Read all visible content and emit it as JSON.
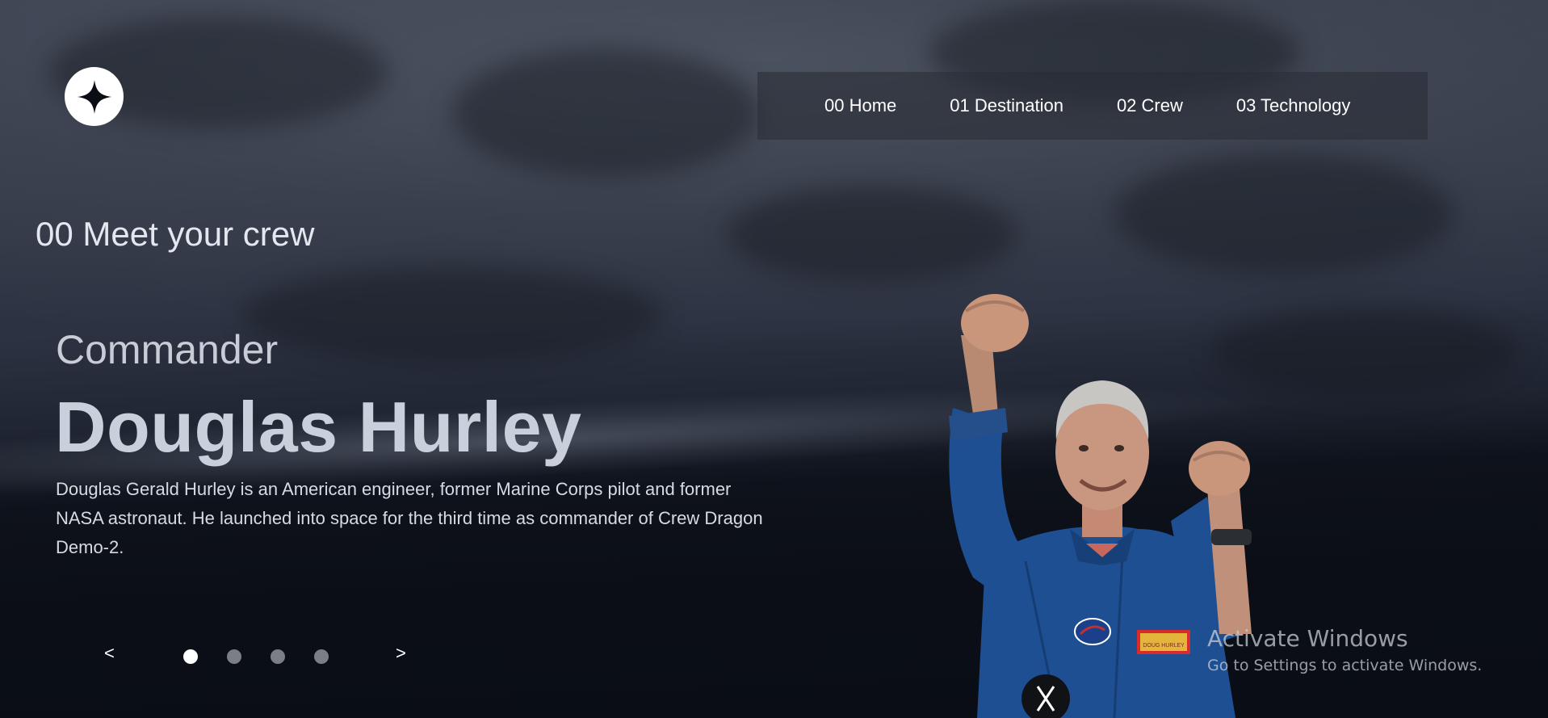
{
  "nav": {
    "items": [
      {
        "label": "00 Home"
      },
      {
        "label": "01 Destination"
      },
      {
        "label": "02 Crew"
      },
      {
        "label": "03 Technology"
      }
    ]
  },
  "page": {
    "section_title": "00 Meet your crew"
  },
  "crew": {
    "role": "Commander",
    "name": "Douglas Hurley",
    "bio": "Douglas Gerald Hurley is an American engineer, former Marine Corps pilot and former NASA astronaut. He launched into space for the third time as commander of Crew Dragon Demo-2."
  },
  "carousel": {
    "prev_label": "<",
    "next_label": ">",
    "active_index": 0,
    "dot_count": 4
  },
  "badge": {
    "name_tag": "DOUG HURLEY"
  },
  "watermark": {
    "title": "Activate Windows",
    "subtitle": "Go to Settings to activate Windows."
  },
  "colors": {
    "background": "#0b0e16",
    "nav_background": "#282c34",
    "text_primary": "#ffffff",
    "name_text": "#c9d0dc",
    "dot_inactive": "#7b7e85",
    "suit_blue": "#1e4f93"
  },
  "icons": {
    "logo": "four-point-star-icon"
  }
}
